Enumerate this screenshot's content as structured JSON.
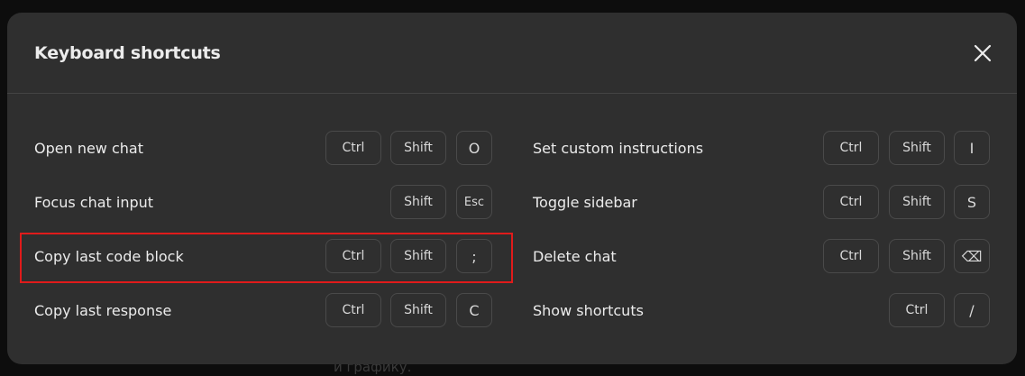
{
  "background_text": {
    "line1": "и графику."
  },
  "modal": {
    "title": "Keyboard shortcuts",
    "close_icon": "close-icon",
    "left_column": [
      {
        "label": "Open new chat",
        "keys": [
          "Ctrl",
          "Shift",
          "O"
        ]
      },
      {
        "label": "Focus chat input",
        "keys": [
          "Shift",
          "Esc"
        ]
      },
      {
        "label": "Copy last code block",
        "keys": [
          "Ctrl",
          "Shift",
          ";"
        ]
      },
      {
        "label": "Copy last response",
        "keys": [
          "Ctrl",
          "Shift",
          "C"
        ]
      }
    ],
    "right_column": [
      {
        "label": "Set custom instructions",
        "keys": [
          "Ctrl",
          "Shift",
          "I"
        ]
      },
      {
        "label": "Toggle sidebar",
        "keys": [
          "Ctrl",
          "Shift",
          "S"
        ]
      },
      {
        "label": "Delete chat",
        "keys": [
          "Ctrl",
          "Shift",
          "⌫"
        ]
      },
      {
        "label": "Show shortcuts",
        "keys": [
          "Ctrl",
          "/"
        ]
      }
    ]
  },
  "colors": {
    "modal_bg": "#2f2f2f",
    "highlight": "#e01b1b",
    "text": "#ececec"
  }
}
